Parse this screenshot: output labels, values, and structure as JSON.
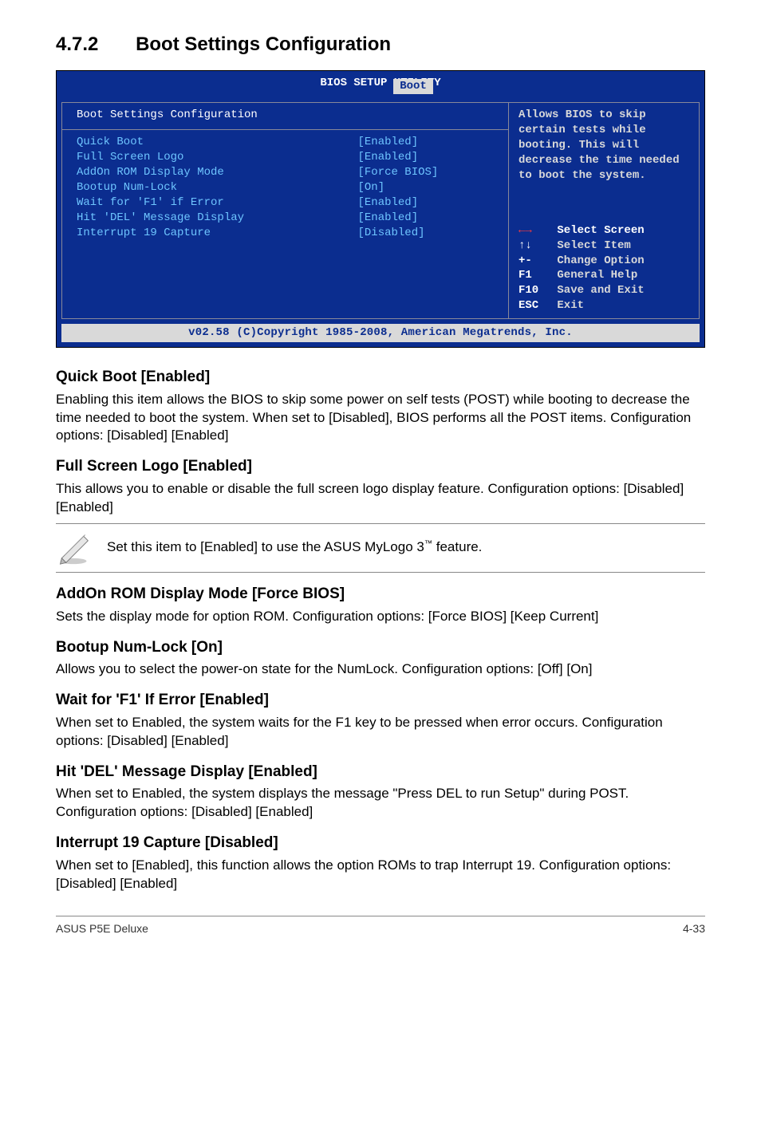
{
  "page": {
    "section_number": "4.7.2",
    "section_title": "Boot Settings Configuration",
    "footer_left": "ASUS P5E Deluxe",
    "footer_right": "4-33"
  },
  "bios": {
    "header": "BIOS SETUP UTILITY",
    "tab": "Boot",
    "left_title": "Boot Settings Configuration",
    "rows": [
      {
        "label": "Quick Boot",
        "value": "[Enabled]"
      },
      {
        "label": "Full Screen Logo",
        "value": "[Enabled]"
      },
      {
        "label": "AddOn ROM Display Mode",
        "value": "[Force BIOS]"
      },
      {
        "label": "Bootup Num-Lock",
        "value": "[On]"
      },
      {
        "label": "Wait for 'F1' if Error",
        "value": "[Enabled]"
      },
      {
        "label": "Hit 'DEL' Message Display",
        "value": "[Enabled]"
      },
      {
        "label": "Interrupt 19 Capture",
        "value": "[Disabled]"
      }
    ],
    "help": "Allows BIOS to skip certain tests while booting. This will decrease the time needed to boot the system.",
    "keys": [
      {
        "key_html": "←→",
        "desc": "Select Screen",
        "arrow": true
      },
      {
        "key_html": "↑↓",
        "desc": "Select Item",
        "arrow": false
      },
      {
        "key_html": "+-",
        "desc": "Change Option",
        "arrow": false
      },
      {
        "key_html": "F1",
        "desc": "General Help",
        "arrow": false
      },
      {
        "key_html": "F10",
        "desc": "Save and Exit",
        "arrow": false
      },
      {
        "key_html": "ESC",
        "desc": "Exit",
        "arrow": false
      }
    ],
    "footer": "v02.58 (C)Copyright 1985-2008, American Megatrends, Inc."
  },
  "sections": {
    "quick_boot": {
      "heading": "Quick Boot [Enabled]",
      "body": "Enabling this item allows the BIOS to skip some power on self tests (POST) while booting to decrease the time needed to boot the system. When set to [Disabled], BIOS performs all the POST items. Configuration options: [Disabled] [Enabled]"
    },
    "full_screen_logo": {
      "heading": "Full Screen Logo [Enabled]",
      "body": "This allows you to enable or disable the full screen logo display feature. Configuration options: [Disabled] [Enabled]"
    },
    "note": {
      "text_pre": "Set this item to [Enabled] to use the ASUS MyLogo 3",
      "text_post": " feature."
    },
    "addon": {
      "heading": "AddOn ROM Display Mode [Force BIOS]",
      "body": "Sets the display mode for option ROM. Configuration options: [Force BIOS] [Keep Current]"
    },
    "numlock": {
      "heading": "Bootup Num-Lock [On]",
      "body": "Allows you to select the power-on state for the NumLock. Configuration options: [Off] [On]"
    },
    "wait_f1": {
      "heading": "Wait for 'F1' If Error [Enabled]",
      "body": "When set to Enabled, the system waits for the F1 key to be pressed when error occurs. Configuration options: [Disabled] [Enabled]"
    },
    "hit_del": {
      "heading": "Hit 'DEL' Message Display [Enabled]",
      "body": "When set to Enabled, the system displays the message \"Press DEL to run Setup\" during POST. Configuration options: [Disabled] [Enabled]"
    },
    "int19": {
      "heading": "Interrupt 19 Capture [Disabled]",
      "body": "When set to [Enabled], this function allows the option ROMs to trap Interrupt 19. Configuration options: [Disabled] [Enabled]"
    }
  }
}
